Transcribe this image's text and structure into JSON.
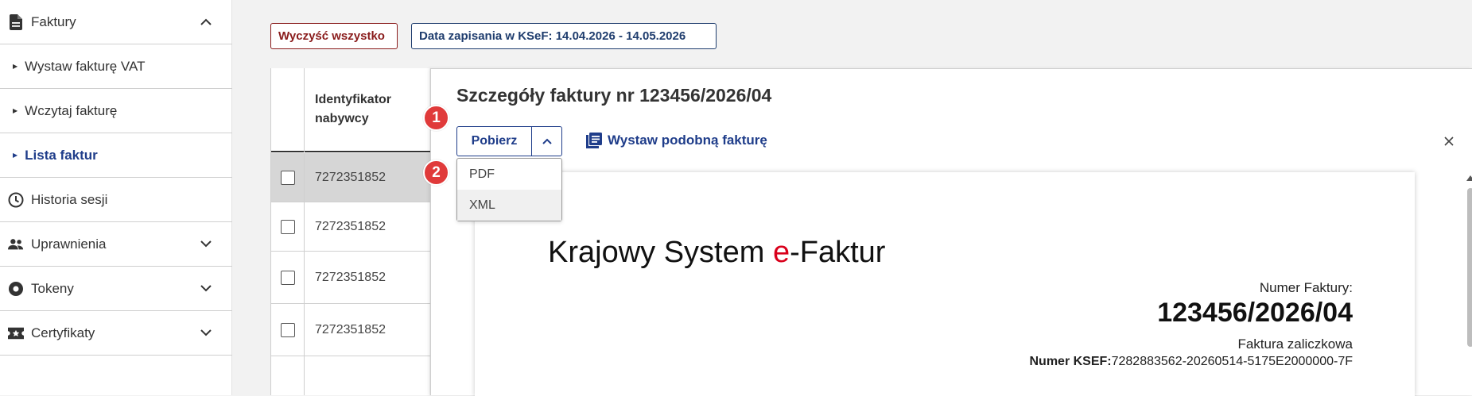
{
  "sidebar": {
    "items": [
      {
        "label": "Faktury",
        "icon": "document-icon",
        "expanded": true
      },
      {
        "label": "Wystaw fakturę VAT",
        "sub": true
      },
      {
        "label": "Wczytaj fakturę",
        "sub": true
      },
      {
        "label": "Lista faktur",
        "sub": true,
        "active": true
      },
      {
        "label": "Historia sesji",
        "icon": "clock-icon"
      },
      {
        "label": "Uprawnienia",
        "icon": "people-icon"
      },
      {
        "label": "Tokeny",
        "icon": "token-icon"
      },
      {
        "label": "Certyfikaty",
        "icon": "certificate-icon"
      }
    ]
  },
  "filters": {
    "clear_label": "Wyczyść wszystko",
    "date_label": "Data zapisania w KSeF: 14.04.2026 - 14.05.2026"
  },
  "table": {
    "header": "Identyfikator nabywcy",
    "rows": [
      "7272351852",
      "7272351852",
      "7272351852",
      "7272351852"
    ]
  },
  "panel": {
    "title": "Szczegóły faktury nr 123456/2026/04",
    "download_label": "Pobierz",
    "similar_label": "Wystaw podobną fakturę",
    "menu": [
      "PDF",
      "XML"
    ],
    "badges": [
      "1",
      "2"
    ]
  },
  "document": {
    "title_prefix": "Krajowy System ",
    "title_e": "e",
    "title_suffix": "-Faktur",
    "number_label": "Numer Faktury:",
    "number": "123456/2026/04",
    "type": "Faktura zaliczkowa",
    "ksef_label": "Numer KSEF:",
    "ksef_value": "7282883562-20260514-5175E2000000-7F"
  },
  "colors": {
    "accent": "#1f3d8a",
    "danger": "#8a1c1c",
    "badge": "#e03a3a"
  }
}
